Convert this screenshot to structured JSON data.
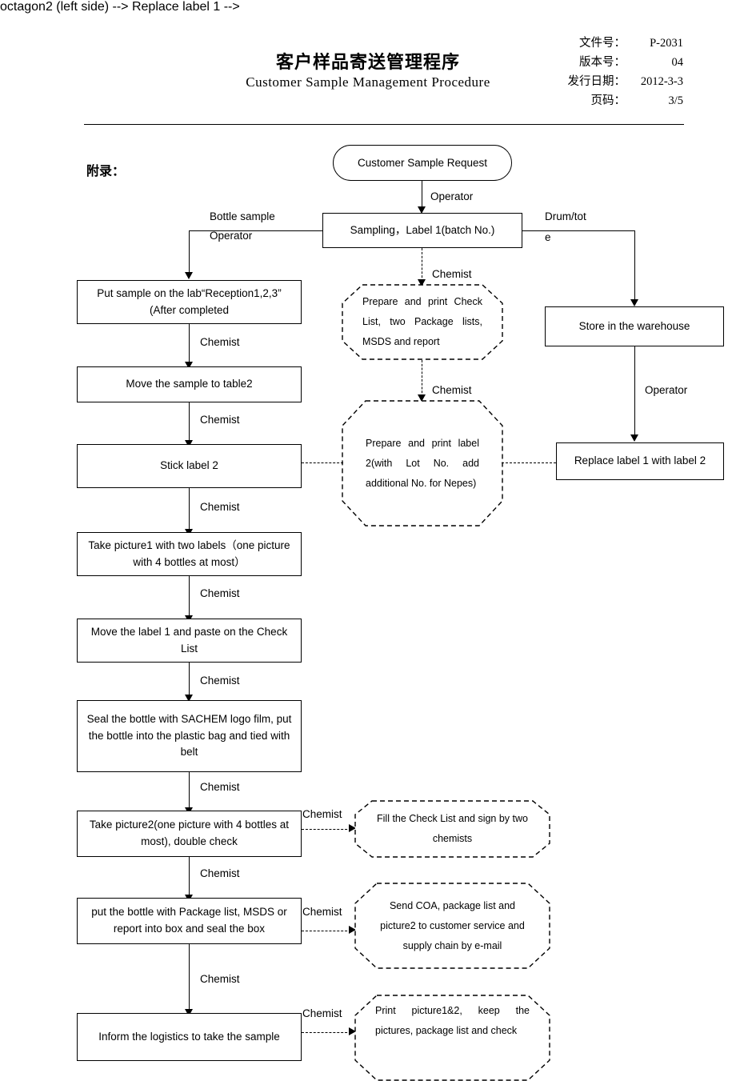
{
  "header": {
    "title_cn": "客户样品寄送管理程序",
    "title_en": "Customer  Sample  Management  Procedure",
    "meta": [
      {
        "key": "文件号：",
        "value": "P-2031"
      },
      {
        "key": "版本号：",
        "value": "04"
      },
      {
        "key": "发行日期：",
        "value": "2012-3-3"
      },
      {
        "key": "页码：",
        "value": "3/5"
      }
    ]
  },
  "appendix_label": "附录：",
  "flow": {
    "start": "Customer Sample Request",
    "sampling": "Sampling，Label 1(batch No.)",
    "left_column": [
      "Put sample on the lab“Reception1,2,3” (After completed",
      "Move the sample to table2",
      "Stick label 2",
      "Take picture1 with two labels（one picture with 4 bottles at most）",
      "Move the label 1 and paste on the Check List",
      "Seal the bottle with SACHEM logo film, put the bottle into the plastic bag and tied with belt",
      "Take picture2(one picture with 4 bottles at most), double check",
      "put the bottle with Package list, MSDS or report into box and seal the box",
      "Inform the logistics to take the sample"
    ],
    "right_column": [
      "Store in the warehouse",
      "Replace label 1 with label 2"
    ],
    "octagons": [
      "Prepare and print Check List, two Package lists, MSDS and report",
      "Prepare and print label 2(with Lot No. add additional No. for Nepes)",
      "Fill the Check List and sign by two chemists",
      "Send COA, package list and picture2 to customer service and supply chain by e-mail",
      "Print picture1&2, keep the pictures, package list and check"
    ],
    "edge_labels": {
      "operator": "Operator",
      "chemist": "Chemist",
      "bottle_sample": "Bottle sample",
      "drum_tote_1": "Drum/tot",
      "drum_tote_2": "e"
    }
  },
  "colors": {
    "ink": "#000000",
    "paper": "#ffffff"
  }
}
